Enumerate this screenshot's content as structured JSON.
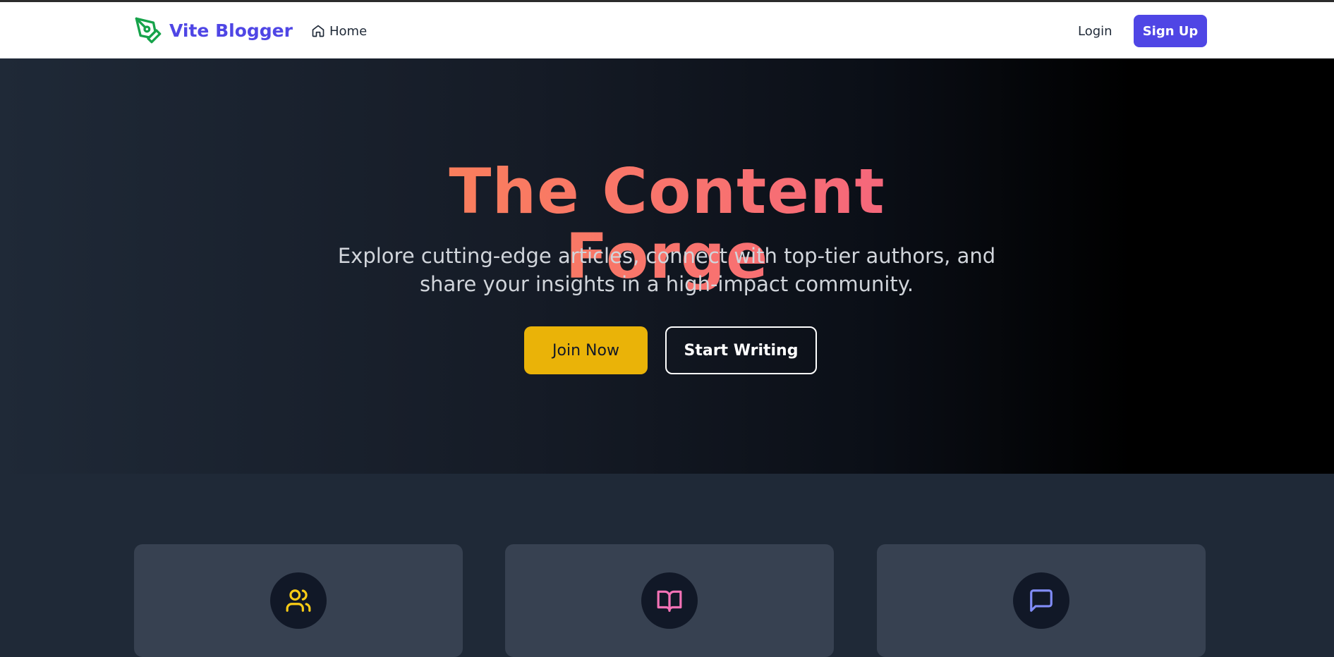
{
  "brand": {
    "name": "Vite Blogger",
    "icon": "pen-nib-icon",
    "icon_color": "#16a34a",
    "color": "#4f46e5"
  },
  "nav": {
    "home_label": "Home",
    "home_icon": "home-icon",
    "login_label": "Login",
    "signup_label": "Sign Up"
  },
  "hero": {
    "title": "The Content Forge",
    "subtitle": "Explore cutting-edge articles, connect with top-tier authors, and share your insights in a high-impact community.",
    "primary_button": "Join Now",
    "secondary_button": "Start Writing",
    "title_gradient": [
      "#fb923c",
      "#ec4899"
    ]
  },
  "features": {
    "cards": [
      {
        "icon": "users-icon",
        "icon_color": "#facc15"
      },
      {
        "icon": "book-open-icon",
        "icon_color": "#f472b6"
      },
      {
        "icon": "message-square-icon",
        "icon_color": "#818cf8"
      }
    ]
  },
  "colors": {
    "accent": "#4f46e5",
    "primary_button": "#eab308"
  }
}
